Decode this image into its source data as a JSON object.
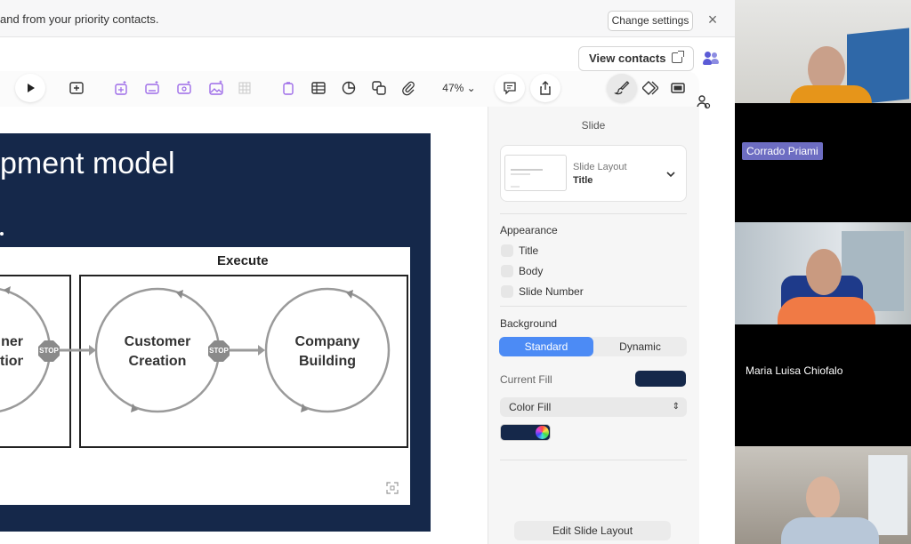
{
  "notification": {
    "text": "and from your priority contacts.",
    "change_settings": "Change settings",
    "close": "×"
  },
  "contacts": {
    "view_contacts": "View contacts"
  },
  "toolbar": {
    "zoom": "47%",
    "zoom_arrow": "⌄"
  },
  "slide": {
    "title": "pment model",
    "execute_label": "Execute",
    "circles": [
      {
        "line1": "ner",
        "line2": "tion"
      },
      {
        "line1": "Customer",
        "line2": "Creation"
      },
      {
        "line1": "Company",
        "line2": "Building"
      }
    ],
    "stop_label": "STOP"
  },
  "panel": {
    "header": "Slide",
    "layout_label": "Slide Layout",
    "layout_value": "Title",
    "appearance_heading": "Appearance",
    "appearance_items": [
      "Title",
      "Body",
      "Slide Number"
    ],
    "background_heading": "Background",
    "segment_standard": "Standard",
    "segment_dynamic": "Dynamic",
    "current_fill_label": "Current Fill",
    "fill_type": "Color Fill",
    "edit_layout_button": "Edit Slide Layout"
  },
  "participants": [
    {
      "name": ""
    },
    {
      "name": "Corrado Priami"
    },
    {
      "name": ""
    },
    {
      "name": "Maria Luisa Chiofalo"
    },
    {
      "name": ""
    }
  ],
  "colors": {
    "slide_bg": "#15284a",
    "accent_blue": "#4c8bf5",
    "insert_icons": "#9d6be8",
    "name_badge": "#6d6dc2"
  }
}
